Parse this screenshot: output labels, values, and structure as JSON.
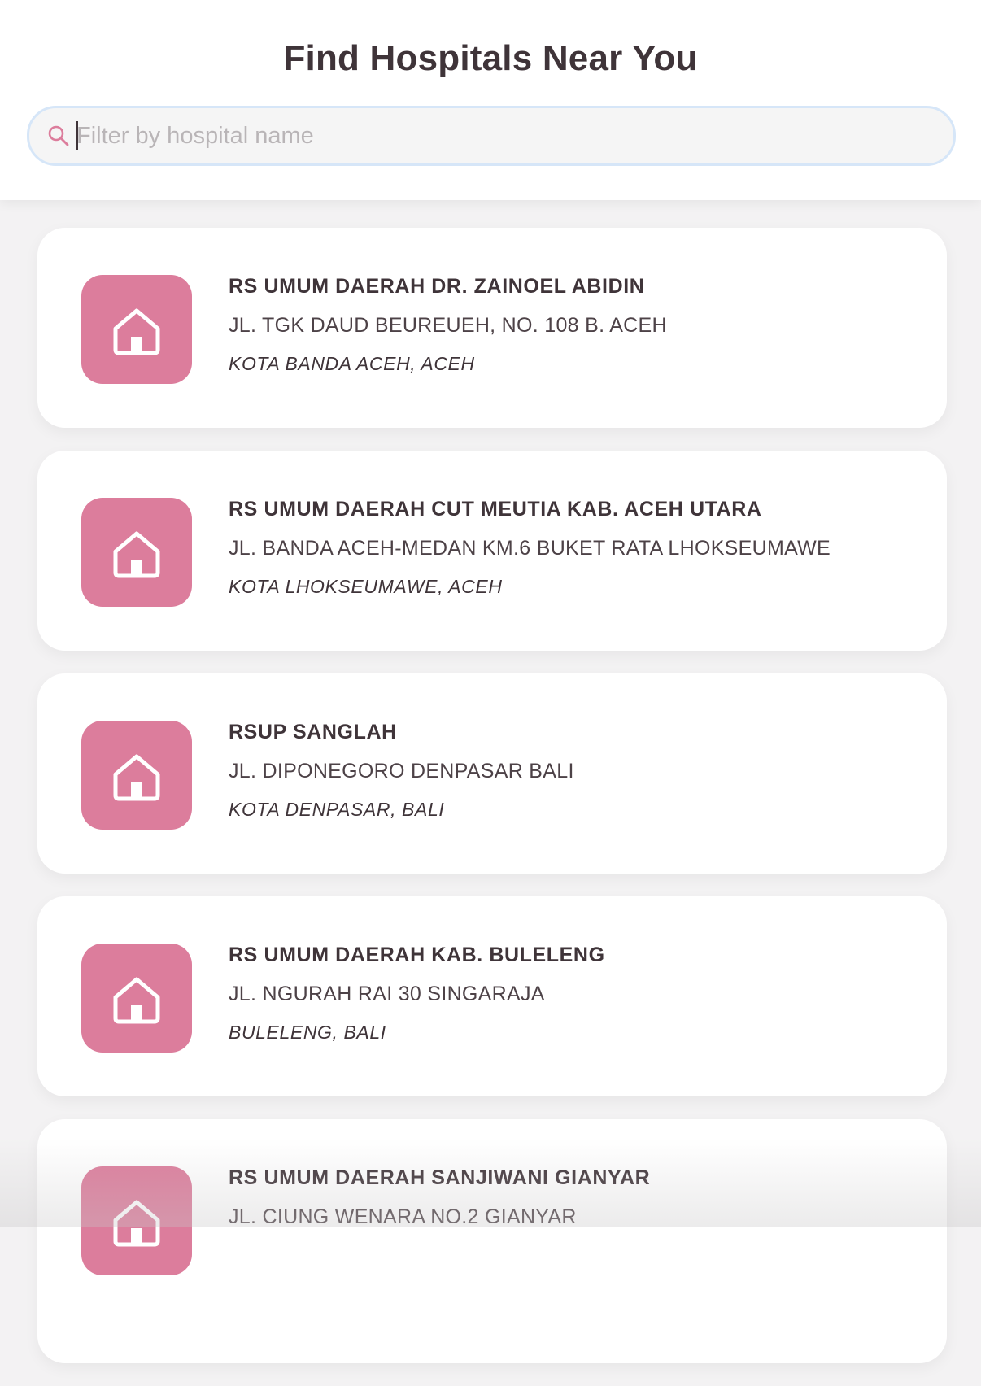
{
  "header": {
    "title": "Find Hospitals Near You"
  },
  "search": {
    "placeholder": "Filter by hospital name",
    "value": "",
    "icon": "search-icon"
  },
  "colors": {
    "accent": "#dc7d9c",
    "text": "#3f3439",
    "search_border": "#d6e6f8"
  },
  "hospitals": [
    {
      "name": "RS UMUM DAERAH DR. ZAINOEL ABIDIN",
      "address": "JL. TGK DAUD BEUREUEH, NO. 108 B. ACEH",
      "city": "KOTA BANDA ACEH, ACEH",
      "icon": "home-icon"
    },
    {
      "name": "RS UMUM DAERAH CUT MEUTIA KAB. ACEH UTARA",
      "address": "JL. BANDA ACEH-MEDAN KM.6 BUKET RATA LHOKSEUMAWE",
      "city": "KOTA LHOKSEUMAWE, ACEH",
      "icon": "home-icon"
    },
    {
      "name": "RSUP SANGLAH",
      "address": "JL. DIPONEGORO DENPASAR BALI",
      "city": "KOTA DENPASAR, BALI",
      "icon": "home-icon"
    },
    {
      "name": "RS UMUM DAERAH KAB. BULELENG",
      "address": "JL. NGURAH RAI 30 SINGARAJA",
      "city": "BULELENG, BALI",
      "icon": "home-icon"
    },
    {
      "name": "RS UMUM DAERAH SANJIWANI GIANYAR",
      "address": "JL. CIUNG WENARA NO.2 GIANYAR",
      "city": "",
      "icon": "home-icon"
    }
  ]
}
